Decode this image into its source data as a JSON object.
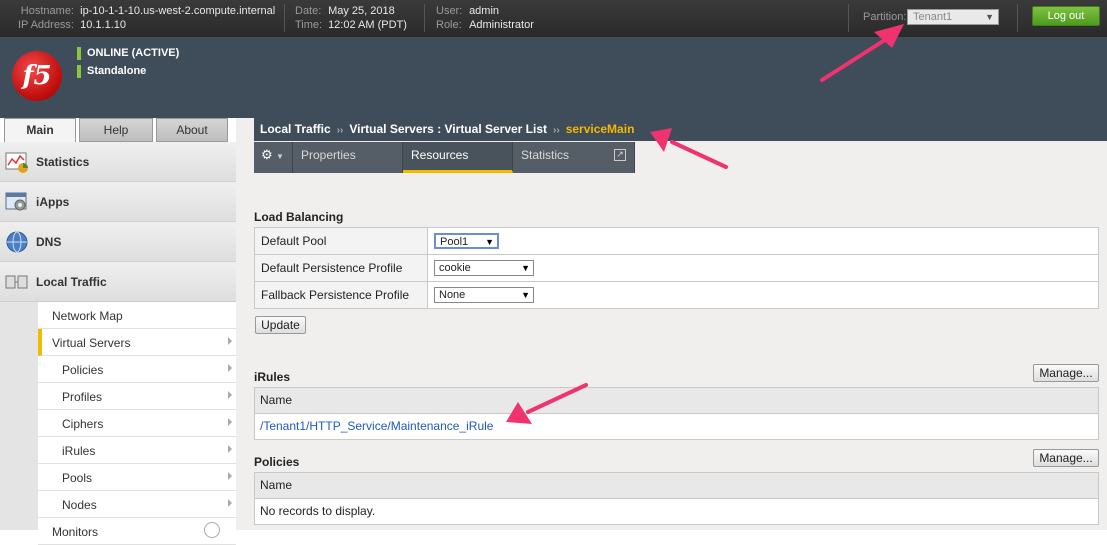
{
  "header": {
    "hostname_label": "Hostname:",
    "hostname": "ip-10-1-1-10.us-west-2.compute.internal",
    "ip_label": "IP Address:",
    "ip": "10.1.1.10",
    "date_label": "Date:",
    "date": "May 25, 2018",
    "time_label": "Time:",
    "time": "12:02 AM (PDT)",
    "user_label": "User:",
    "user": "admin",
    "role_label": "Role:",
    "role": "Administrator",
    "partition_label": "Partition:",
    "partition": "Tenant1",
    "logout_label": "Log out"
  },
  "banner": {
    "logo_text": "f5",
    "status_online": "ONLINE (ACTIVE)",
    "status_mode": "Standalone",
    "status_color": "#8cc63e"
  },
  "nav_tabs": {
    "main": "Main",
    "help": "Help",
    "about": "About"
  },
  "sidebar": {
    "sections": [
      {
        "label": "Statistics",
        "icon": "statistics-chart-icon"
      },
      {
        "label": "iApps",
        "icon": "iapps-gear-icon"
      },
      {
        "label": "DNS",
        "icon": "dns-globe-icon"
      },
      {
        "label": "Local Traffic",
        "icon": "local-traffic-icon"
      }
    ],
    "items": [
      {
        "label": "Network Map"
      },
      {
        "label": "Virtual Servers"
      },
      {
        "label": "Policies"
      },
      {
        "label": "Profiles"
      },
      {
        "label": "Ciphers"
      },
      {
        "label": "iRules"
      },
      {
        "label": "Pools"
      },
      {
        "label": "Nodes"
      },
      {
        "label": "Monitors"
      }
    ]
  },
  "breadcrumb": {
    "part1": "Local Traffic",
    "part2": "Virtual Servers : Virtual Server List",
    "current": "serviceMain",
    "separator": "››"
  },
  "tabs": {
    "properties": "Properties",
    "resources": "Resources",
    "statistics": "Statistics"
  },
  "load_balancing": {
    "title": "Load Balancing",
    "rows": [
      {
        "label": "Default Pool",
        "value": "Pool1"
      },
      {
        "label": "Default Persistence Profile",
        "value": "cookie"
      },
      {
        "label": "Fallback Persistence Profile",
        "value": "None"
      }
    ],
    "update_label": "Update"
  },
  "irules": {
    "title": "iRules",
    "manage_label": "Manage...",
    "column": "Name",
    "entry": "/Tenant1/HTTP_Service/Maintenance_iRule"
  },
  "policies": {
    "title": "Policies",
    "manage_label": "Manage...",
    "column": "Name",
    "empty": "No records to display."
  },
  "colors": {
    "accent_yellow": "#f5b800",
    "header_dark": "#3f4d5a",
    "logout_green": "#5ea828",
    "annotation_pink": "#f0336e"
  }
}
